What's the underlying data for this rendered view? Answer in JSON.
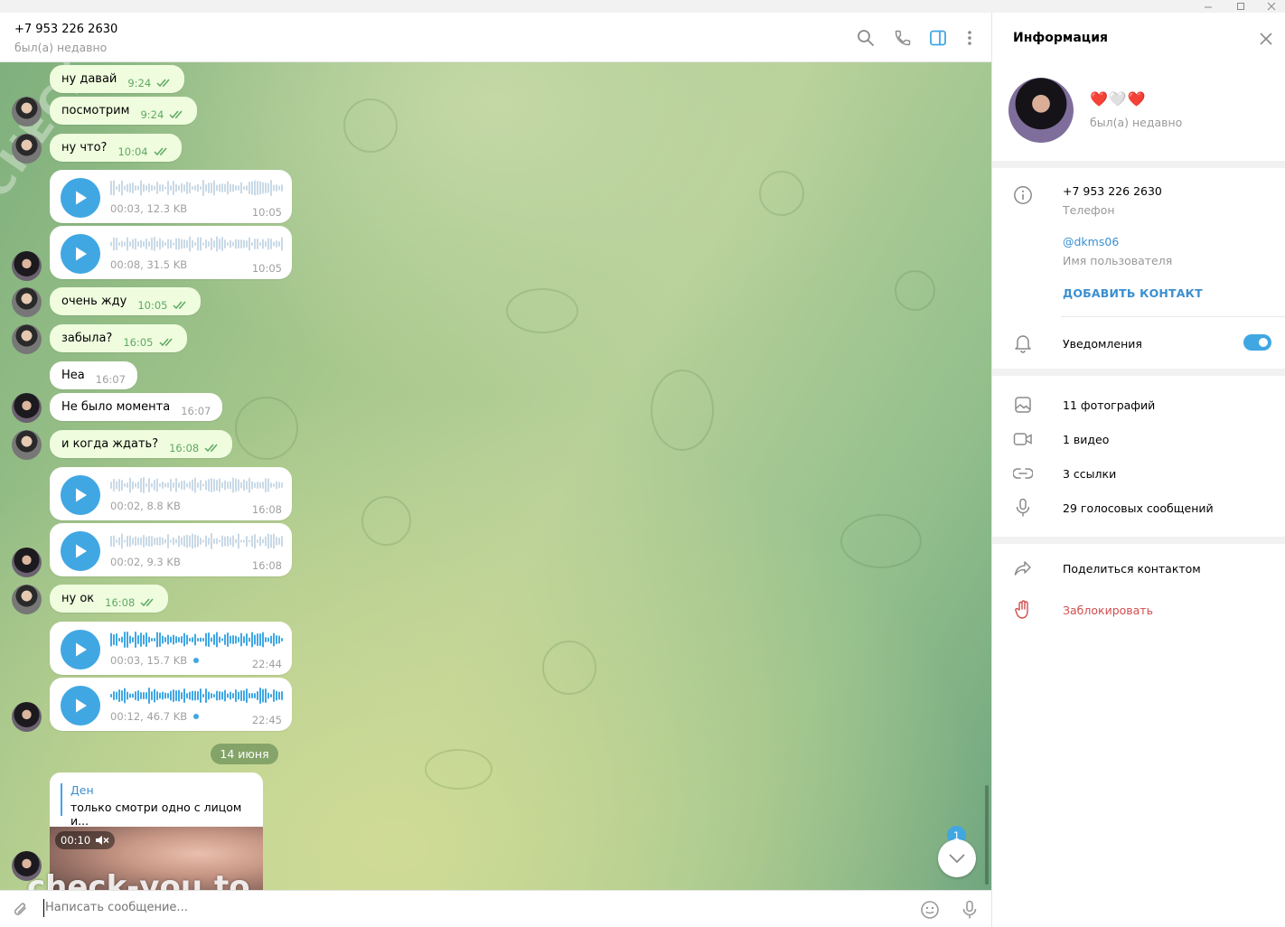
{
  "window": {
    "controls": [
      "minimize",
      "maximize",
      "close"
    ]
  },
  "header": {
    "title": "+7 953 226 2630",
    "status": "был(а) недавно",
    "icons": [
      "search-icon",
      "phone-icon",
      "sidebar-toggle-icon",
      "more-icon"
    ]
  },
  "chat": {
    "messages": [
      {
        "kind": "text",
        "text": "ну давай",
        "time": "9:24",
        "ticks": true
      },
      {
        "kind": "text",
        "text": "посмотрим",
        "time": "9:24",
        "ticks": true
      },
      {
        "kind": "text",
        "text": "ну что?",
        "time": "10:04",
        "ticks": true
      },
      {
        "kind": "voice",
        "meta": "00:03, 12.3 KB",
        "time": "10:05"
      },
      {
        "kind": "voice",
        "meta": "00:08, 31.5 KB",
        "time": "10:05"
      },
      {
        "kind": "text",
        "text": "очень жду",
        "time": "10:05",
        "ticks": true
      },
      {
        "kind": "text",
        "text": "забыла?",
        "time": "16:05",
        "ticks": true
      },
      {
        "kind": "text",
        "text": "Неа",
        "time": "16:07",
        "ticks": false
      },
      {
        "kind": "text",
        "text": "Не было момента",
        "time": "16:07",
        "ticks": false
      },
      {
        "kind": "text",
        "text": "и когда ждать?",
        "time": "16:08",
        "ticks": true
      },
      {
        "kind": "voice",
        "meta": "00:02, 8.8 KB",
        "time": "16:08"
      },
      {
        "kind": "voice",
        "meta": "00:02, 9.3 KB",
        "time": "16:08"
      },
      {
        "kind": "text",
        "text": "ну ок",
        "time": "16:08",
        "ticks": true
      },
      {
        "kind": "voice",
        "meta": "00:03, 15.7 KB",
        "time": "22:44",
        "unplayed": true
      },
      {
        "kind": "voice",
        "meta": "00:12, 46.7 KB",
        "time": "22:45",
        "unplayed": true
      }
    ],
    "date_separator": "14 июня",
    "media_message": {
      "reply_name": "Ден",
      "reply_text": "только смотри одно с лицом и...",
      "duration": "00:10"
    },
    "unread_count": "1"
  },
  "watermarks": {
    "bottom": "check-you.to",
    "diagonal": "CHECKYOU.ME"
  },
  "composer": {
    "placeholder": "Написать сообщение..."
  },
  "info": {
    "title": "Информация",
    "profile_name": "❤️🤍❤️",
    "profile_status": "был(а) недавно",
    "phone": "+7 953 226 2630",
    "phone_label": "Телефон",
    "username": "@dkms06",
    "username_label": "Имя пользователя",
    "add_contact": "ДОБАВИТЬ КОНТАКТ",
    "notifications": "Уведомления",
    "notifications_on": true,
    "media": [
      {
        "icon": "photo-icon",
        "label": "11 фотографий"
      },
      {
        "icon": "video-icon",
        "label": "1 видео"
      },
      {
        "icon": "link-icon",
        "label": "3 ссылки"
      },
      {
        "icon": "mic-icon",
        "label": "29 голосовых сообщений"
      }
    ],
    "share_contact": "Поделиться контактом",
    "block": "Заблокировать"
  },
  "colors": {
    "accent": "#40a7e3",
    "outgoing_bubble": "#effdde",
    "outgoing_time": "#5fa864",
    "danger": "#d14e4e"
  }
}
